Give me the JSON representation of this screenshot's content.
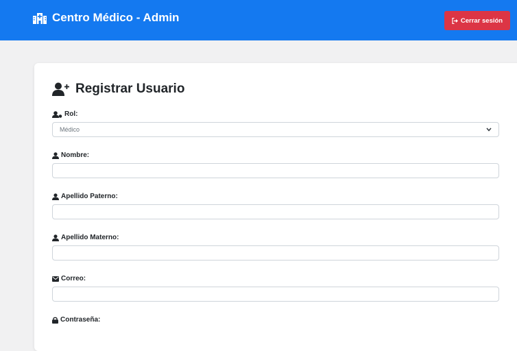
{
  "header": {
    "title": "Centro Médico - Admin",
    "logout_label": "Cerrar sesión",
    "brand_icon": "hospital-icon",
    "logout_icon": "sign-out-icon",
    "colors": {
      "navbar": "#1479f0",
      "logout": "#dc3545"
    }
  },
  "form": {
    "title": "Registrar Usuario",
    "title_icon": "user-plus-icon",
    "fields": {
      "rol": {
        "label": "Rol:",
        "icon": "users-cog-icon",
        "value": "Médico"
      },
      "nombre": {
        "label": "Nombre:",
        "icon": "user-icon",
        "value": ""
      },
      "apellido_paterno": {
        "label": "Apellido Paterno:",
        "icon": "user-icon",
        "value": ""
      },
      "apellido_materno": {
        "label": "Apellido Materno:",
        "icon": "user-icon",
        "value": ""
      },
      "correo": {
        "label": "Correo:",
        "icon": "envelope-icon",
        "value": ""
      },
      "contrasena": {
        "label": "Contraseña:",
        "icon": "lock-icon"
      }
    }
  }
}
